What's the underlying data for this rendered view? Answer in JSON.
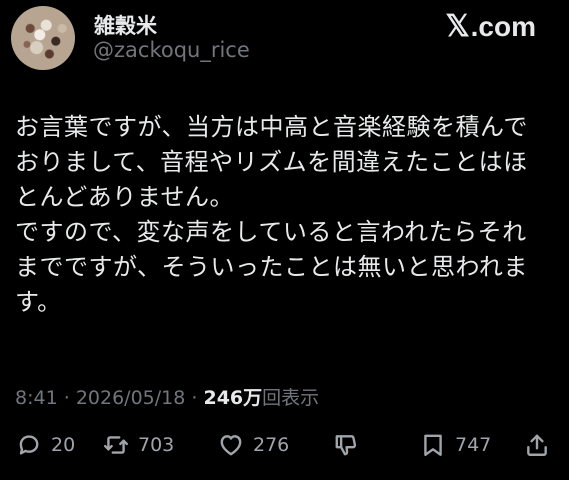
{
  "author": {
    "display_name": "雑穀米",
    "handle": "@zackoqu_rice",
    "avatar_icon": "avatar-image"
  },
  "brand": {
    "x_mark": "𝕏",
    "domain": ".com"
  },
  "tweet": {
    "text": "お言葉ですが、当方は中高と音楽経験を積んで\nおりまして、音程やリズムを間違えたことはほ\nとんどありません。\nですので、変な声をしていると言われたらそれ\nまでですが、そういったことは無いと思われま\nす。"
  },
  "meta": {
    "time": "8:41",
    "sep1": "·",
    "date": "2026/05/18",
    "sep2": "·",
    "views_count": "246万",
    "views_label": "回表示"
  },
  "actions": {
    "reply": {
      "icon": "reply-icon",
      "count": "20"
    },
    "repost": {
      "icon": "repost-icon",
      "count": "703"
    },
    "like": {
      "icon": "heart-icon",
      "count": "276"
    },
    "dislike": {
      "icon": "thumbs-down-icon"
    },
    "bookmark": {
      "icon": "bookmark-icon",
      "count": "747"
    },
    "share": {
      "icon": "share-icon"
    }
  },
  "colors": {
    "background": "#000000",
    "primary_text": "#e7e9ea",
    "secondary_text": "#71767b"
  }
}
